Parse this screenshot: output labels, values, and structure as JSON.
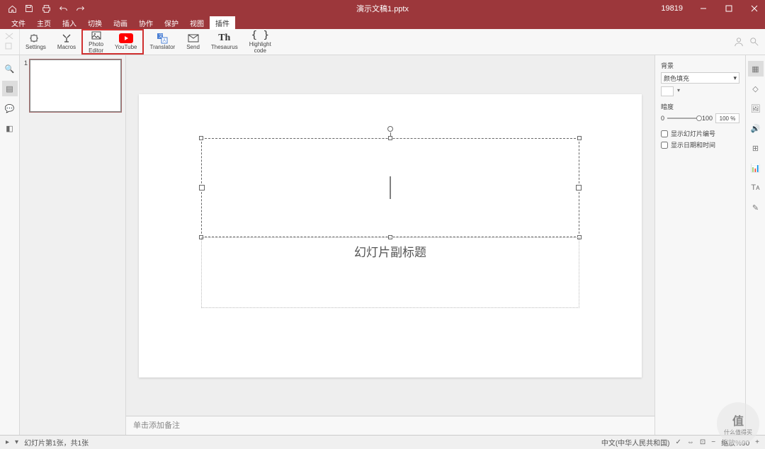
{
  "titlebar": {
    "filename": "演示文稿1.pptx",
    "user": "19819"
  },
  "menu": {
    "items": [
      "文件",
      "主页",
      "插入",
      "切换",
      "动画",
      "协作",
      "保护",
      "视图",
      "插件"
    ],
    "active_index": 8
  },
  "ribbon": {
    "settings": "Settings",
    "macros": "Macros",
    "photo_editor": "Photo\nEditor",
    "youtube": "YouTube",
    "translator": "Translator",
    "send": "Send",
    "thesaurus": "Thesaurus",
    "highlight": "Highlight\ncode"
  },
  "slide": {
    "subtitle_placeholder": "幻灯片副标题"
  },
  "notes": {
    "placeholder": "单击添加备注"
  },
  "thumb": {
    "num": "1"
  },
  "right_panel": {
    "bg_label": "背景",
    "fill_type": "颜色填充",
    "opacity_label": "暗度",
    "opacity_min": "0",
    "opacity_max": "100",
    "opacity_val": "100 %",
    "show_slide_num": "显示幻灯片编号",
    "show_datetime": "显示日期和时间"
  },
  "statusbar": {
    "slide_info": "幻灯片第1张，共1张",
    "language": "中文(中华人民共和国)",
    "zoom": "缩放%90"
  },
  "watermark": {
    "t1": "值",
    "t2": "什么值得买"
  }
}
